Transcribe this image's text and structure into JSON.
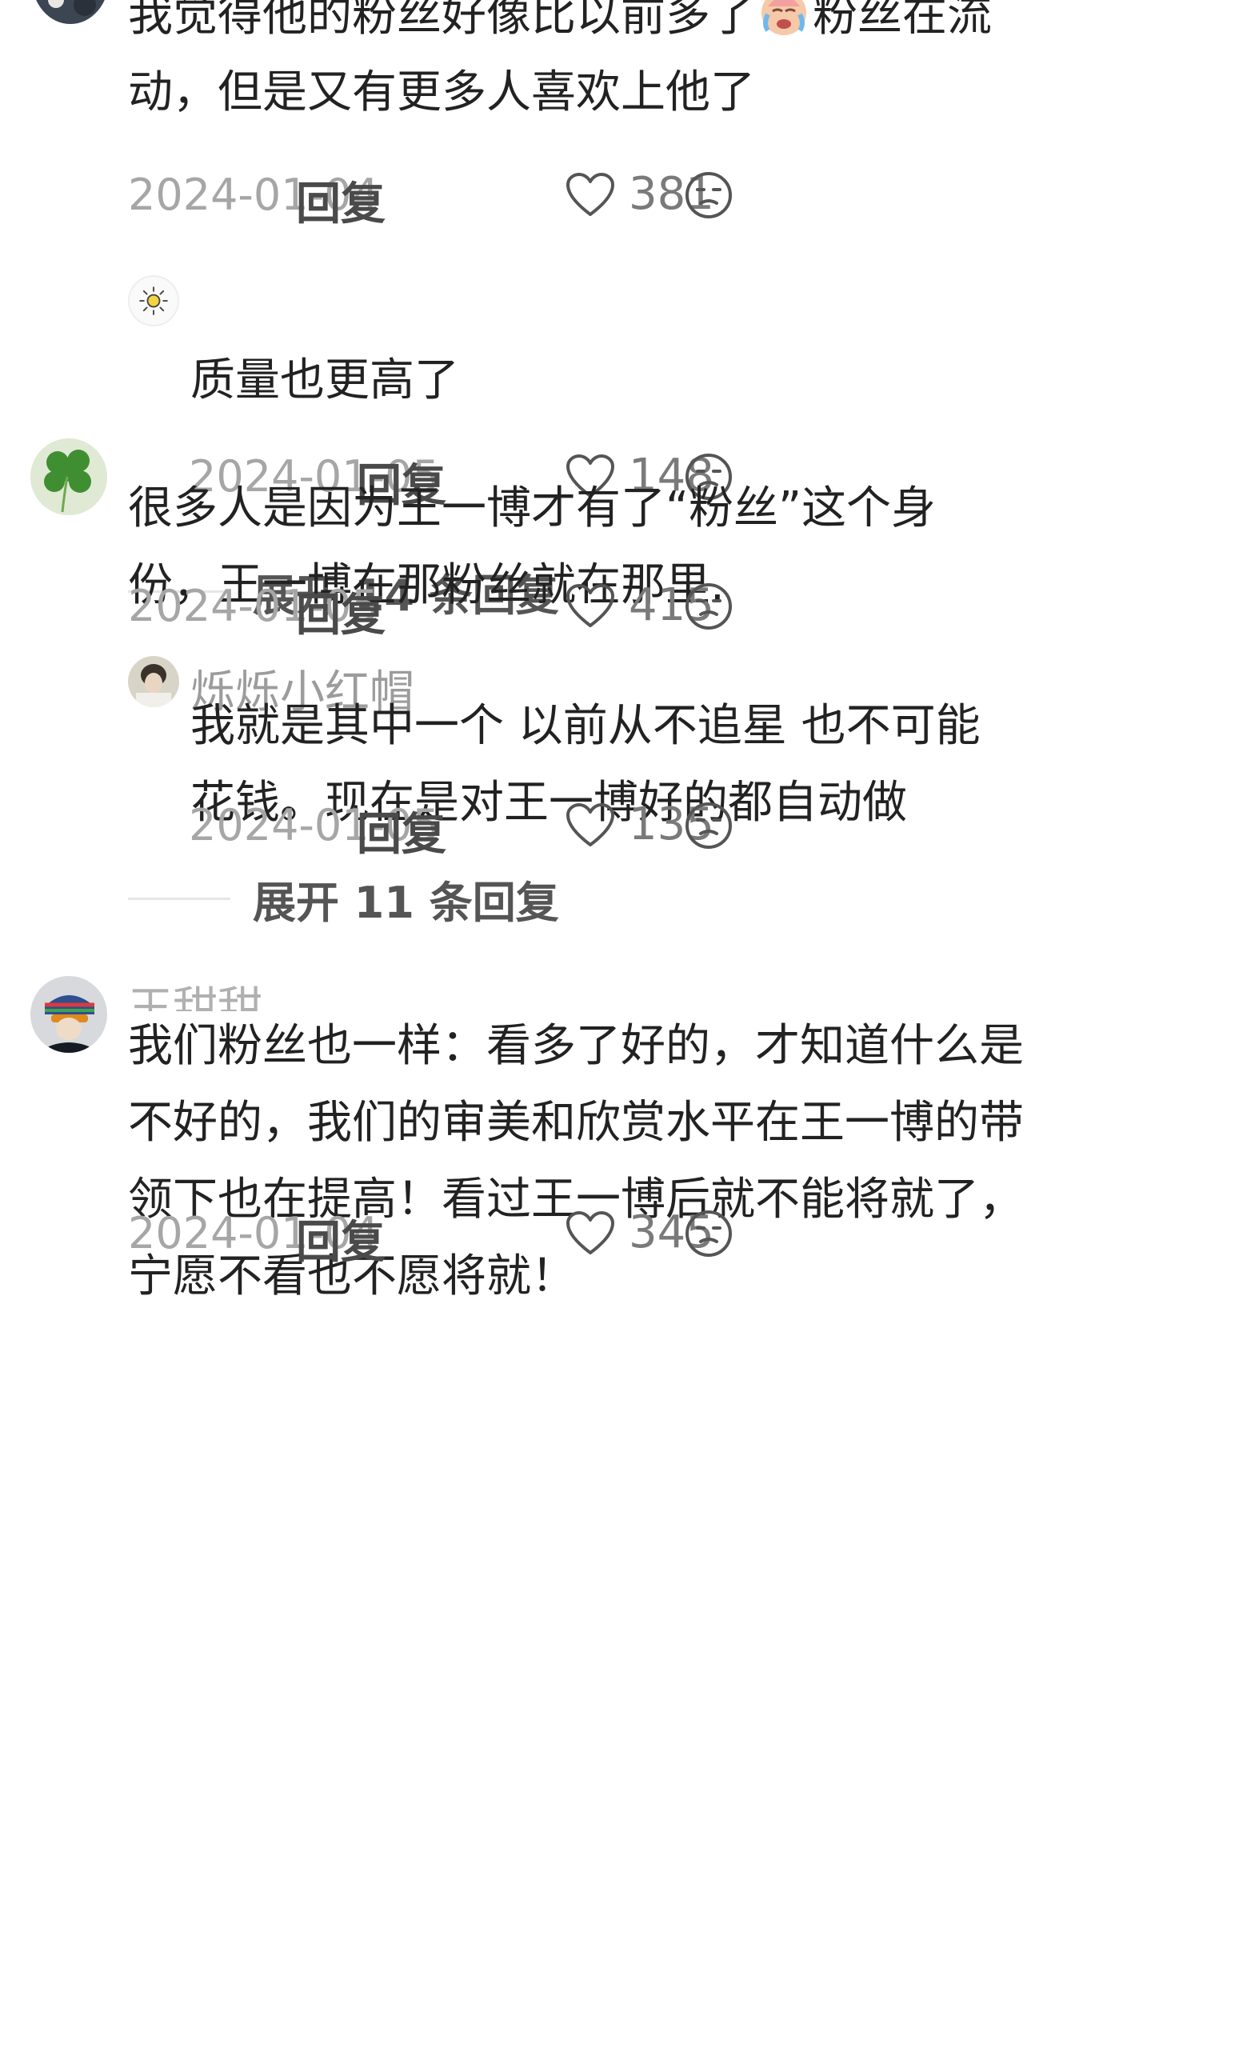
{
  "comments": [
    {
      "text_lines": [
        "我觉得他的粉丝好像比以前多了",
        "粉丝在流",
        "动，但是又有更多人喜欢上他了"
      ],
      "date": "2024-01-04",
      "reply_label": "回复",
      "likes": "381",
      "replies": [
        {
          "username": "",
          "text_lines": [
            "质量也更高了"
          ],
          "date": "2024-01-05",
          "reply_label": "回复",
          "likes": "148"
        }
      ],
      "expand_label": "展开 14 条回复"
    },
    {
      "username": "",
      "text_lines": [
        "很多人是因为王一博才有了“粉丝”这个身",
        "份，王一博在那粉丝就在那里."
      ],
      "date": "2024-01-05",
      "reply_label": "回复",
      "likes": "415",
      "replies": [
        {
          "username": "烁烁小红帽",
          "text_lines": [
            "我就是其中一个 以前从不追星 也不可能",
            "花钱。现在是对王一博好的都自动做"
          ],
          "date": "2024-01-05",
          "reply_label": "回复",
          "likes": "135"
        }
      ],
      "expand_label": "展开 11 条回复"
    },
    {
      "username": "王甜甜",
      "text_lines": [
        "我们粉丝也一样：看多了好的，才知道什么是",
        "不好的，我们的审美和欣赏水平在王一博的带",
        "领下也在提高！看过王一博后就不能将就了，",
        "宁愿不看也不愿将就！"
      ],
      "date": "2024-01-04",
      "reply_label": "回复",
      "likes": "345"
    }
  ],
  "icons": {
    "like": "heart-outline-icon",
    "emoji": "neutral-face-icon",
    "inline_emoji": "crying-face-emoji",
    "avatar_2": "four-leaf-clover",
    "reply_avatar_1": "sun-icon"
  },
  "colors": {
    "body_text": "#222222",
    "meta_text": "#a6a6a6",
    "username": "#9c9c9c",
    "icon_stroke": "#555555"
  }
}
